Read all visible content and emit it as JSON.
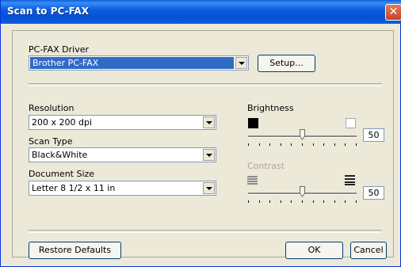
{
  "window": {
    "title": "Scan to PC-FAX",
    "close_glyph": "✕"
  },
  "driver": {
    "label": "PC-FAX Driver",
    "value": "Brother PC-FAX",
    "setup_label": "Setup..."
  },
  "resolution": {
    "label": "Resolution",
    "value": "200 x 200 dpi"
  },
  "scan_type": {
    "label": "Scan Type",
    "value": "Black&White"
  },
  "document_size": {
    "label": "Document Size",
    "value": "Letter 8 1/2 x 11 in"
  },
  "brightness": {
    "label": "Brightness",
    "value": "50",
    "level_percent": 50,
    "icon_low": "black-square-icon",
    "icon_high": "white-square-icon"
  },
  "contrast": {
    "label": "Contrast",
    "value": "50",
    "level_percent": 50,
    "enabled": false,
    "icon_low": "low-contrast-icon",
    "icon_high": "high-contrast-icon"
  },
  "buttons": {
    "restore_defaults": "Restore Defaults",
    "ok": "OK",
    "cancel": "Cancel"
  },
  "colors": {
    "title_bar": "#0a5fdc",
    "selection": "#316ac5",
    "dialog_bg": "#ece9d8"
  }
}
